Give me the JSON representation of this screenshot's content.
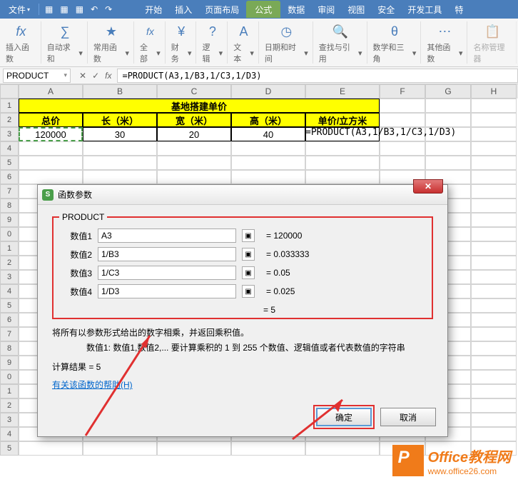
{
  "menu": {
    "file": "文件",
    "items": [
      "开始",
      "插入",
      "页面布局",
      "公式",
      "数据",
      "审阅",
      "视图",
      "安全",
      "开发工具",
      "特"
    ]
  },
  "ribbon": {
    "insert_fn": "插入函数",
    "autosum": "自动求和",
    "common": "常用函数",
    "all": "全部",
    "finance": "财务",
    "logic": "逻辑",
    "text": "文本",
    "datetime": "日期和时间",
    "lookup": "查找与引用",
    "math": "数学和三角",
    "other": "其他函数",
    "name_mgr": "名称管理器"
  },
  "formula_bar": {
    "name_box": "PRODUCT",
    "formula": "=PRODUCT(A3,1/B3,1/C3,1/D3)"
  },
  "columns": [
    "A",
    "B",
    "C",
    "D",
    "E",
    "F",
    "G",
    "H"
  ],
  "sheet": {
    "title": "基地搭建单价",
    "headers": [
      "总价",
      "长（米）",
      "宽（米）",
      "高（米）",
      "单价/立方米"
    ],
    "data_row": [
      "120000",
      "30",
      "20",
      "40"
    ],
    "e3_display": "=PRODUCT(A3,1/B3,1/C3,1/D3)"
  },
  "dialog": {
    "title": "函数参数",
    "fn_name": "PRODUCT",
    "params": [
      {
        "label": "数值1",
        "value": "A3",
        "result": "= 120000"
      },
      {
        "label": "数值2",
        "value": "1/B3",
        "result": "= 0.033333"
      },
      {
        "label": "数值3",
        "value": "1/C3",
        "result": "= 0.05"
      },
      {
        "label": "数值4",
        "value": "1/D3",
        "result": "= 0.025"
      }
    ],
    "equals": "= 5",
    "desc1": "将所有以参数形式给出的数字相乘，并返回乘积值。",
    "desc2": "数值1: 数值1,数值2,... 要计算乘积的 1 到 255 个数值、逻辑值或者代表数值的字符串",
    "result_line": "计算结果 = 5",
    "help": "有关该函数的帮助(H)",
    "ok": "确定",
    "cancel": "取消"
  },
  "logo": {
    "title": "Office教程网",
    "url": "www.office26.com"
  }
}
